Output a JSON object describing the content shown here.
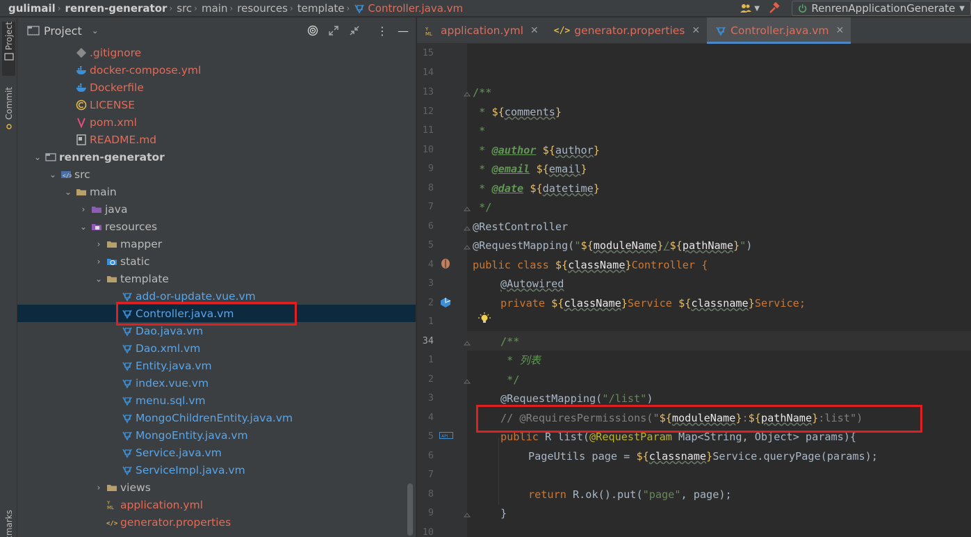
{
  "navbar": {
    "crumbs": [
      "gulimail",
      "renren-generator",
      "src",
      "main",
      "resources",
      "template",
      "Controller.java.vm"
    ],
    "run_config": "RenrenApplicationGenerate"
  },
  "left_strip": {
    "project_tab": "Project",
    "commit_tab": "Commit",
    "bookmarks_tab": "Bookmarks"
  },
  "project_panel": {
    "title": "Project",
    "tree": [
      {
        "label": ".gitignore",
        "depth": 3,
        "color": "red",
        "icon": "gitignore-icon"
      },
      {
        "label": "docker-compose.yml",
        "depth": 3,
        "color": "red",
        "icon": "docker-icon"
      },
      {
        "label": "Dockerfile",
        "depth": 3,
        "color": "red",
        "icon": "docker-icon"
      },
      {
        "label": "LICENSE",
        "depth": 3,
        "color": "red",
        "icon": "license-icon"
      },
      {
        "label": "pom.xml",
        "depth": 3,
        "color": "red",
        "icon": "maven-icon"
      },
      {
        "label": "README.md",
        "depth": 3,
        "color": "red",
        "icon": "markdown-icon"
      },
      {
        "label": "renren-generator",
        "depth": 1,
        "color": "bold",
        "icon": "module-folder-icon",
        "arrow": "down"
      },
      {
        "label": "src",
        "depth": 2,
        "color": "norm",
        "icon": "source-folder-icon",
        "arrow": "down"
      },
      {
        "label": "main",
        "depth": 3,
        "color": "norm",
        "icon": "folder-icon",
        "arrow": "down"
      },
      {
        "label": "java",
        "depth": 4,
        "color": "norm",
        "icon": "java-folder-icon",
        "arrow": "right"
      },
      {
        "label": "resources",
        "depth": 4,
        "color": "norm",
        "icon": "resources-folder-icon",
        "arrow": "down"
      },
      {
        "label": "mapper",
        "depth": 5,
        "color": "norm",
        "icon": "folder-icon",
        "arrow": "right"
      },
      {
        "label": "static",
        "depth": 5,
        "color": "norm",
        "icon": "web-folder-icon",
        "arrow": "right"
      },
      {
        "label": "template",
        "depth": 5,
        "color": "norm",
        "icon": "folder-icon",
        "arrow": "down"
      },
      {
        "label": "add-or-update.vue.vm",
        "depth": 6,
        "color": "blue",
        "icon": "velocity-icon"
      },
      {
        "label": "Controller.java.vm",
        "depth": 6,
        "color": "blue",
        "icon": "velocity-icon",
        "selected": true
      },
      {
        "label": "Dao.java.vm",
        "depth": 6,
        "color": "blue",
        "icon": "velocity-icon"
      },
      {
        "label": "Dao.xml.vm",
        "depth": 6,
        "color": "blue",
        "icon": "velocity-icon"
      },
      {
        "label": "Entity.java.vm",
        "depth": 6,
        "color": "blue",
        "icon": "velocity-icon"
      },
      {
        "label": "index.vue.vm",
        "depth": 6,
        "color": "blue",
        "icon": "velocity-icon"
      },
      {
        "label": "menu.sql.vm",
        "depth": 6,
        "color": "blue",
        "icon": "velocity-icon"
      },
      {
        "label": "MongoChildrenEntity.java.vm",
        "depth": 6,
        "color": "blue",
        "icon": "velocity-icon"
      },
      {
        "label": "MongoEntity.java.vm",
        "depth": 6,
        "color": "blue",
        "icon": "velocity-icon"
      },
      {
        "label": "Service.java.vm",
        "depth": 6,
        "color": "blue",
        "icon": "velocity-icon"
      },
      {
        "label": "ServiceImpl.java.vm",
        "depth": 6,
        "color": "blue",
        "icon": "velocity-icon"
      },
      {
        "label": "views",
        "depth": 5,
        "color": "norm",
        "icon": "folder-icon",
        "arrow": "right"
      },
      {
        "label": "application.yml",
        "depth": 5,
        "color": "red",
        "icon": "yaml-icon"
      },
      {
        "label": "generator.properties",
        "depth": 5,
        "color": "red",
        "icon": "properties-icon"
      }
    ]
  },
  "tabs": [
    {
      "label": "application.yml",
      "icon": "yaml-icon"
    },
    {
      "label": "generator.properties",
      "icon": "properties-icon"
    },
    {
      "label": "Controller.java.vm",
      "icon": "velocity-icon",
      "active": true
    }
  ],
  "editor": {
    "line_numbers": [
      "15",
      "14",
      "13",
      "12",
      "11",
      "10",
      "9",
      "8",
      "7",
      "6",
      "5",
      "4",
      "3",
      "2",
      "1",
      "34",
      "1",
      "2",
      "3",
      "4",
      "5",
      "6",
      "7",
      "8",
      "9",
      "10"
    ],
    "current_line_index": 15,
    "code": {
      "l13": "/**",
      "l12_a": " * ",
      "l12_b": "${",
      "l12_c": "comments",
      "l12_d": "}",
      "l11": " *",
      "l10_a": " * ",
      "l10_tag": "@author",
      "l10_sp": " ",
      "l10_b": "${",
      "l10_c": "author",
      "l10_d": "}",
      "l9_a": " * ",
      "l9_tag": "@email",
      "l9_sp": " ",
      "l9_b": "${",
      "l9_c": "email",
      "l9_d": "}",
      "l8_a": " * ",
      "l8_tag": "@date",
      "l8_sp": " ",
      "l8_b": "${",
      "l8_c": "datetime",
      "l8_d": "}",
      "l7": " */",
      "l6": "@RestController",
      "l5_a": "@RequestMapping(",
      "l5_b": "\"",
      "l5_c": "${",
      "l5_d": "moduleName",
      "l5_e": "}",
      "l5_f": "/",
      "l5_g": "${",
      "l5_h": "pathName",
      "l5_i": "}",
      "l5_j": "\"",
      "l5_k": ")",
      "l4_a": "public class ",
      "l4_b": "${",
      "l4_c": "className",
      "l4_d": "}",
      "l4_e": "Controller {",
      "l3": "@Autowired",
      "l2_a": "private ",
      "l2_b": "${",
      "l2_c": "className",
      "l2_d": "}",
      "l2_e": "Service ",
      "l2_f": "${",
      "l2_g": "classname",
      "l2_h": "}",
      "l2_i": "Service;",
      "c34": "/**",
      "c1_a": " * ",
      "c1_b": "列表",
      "c2": " */",
      "c3_a": "@RequestMapping(",
      "c3_b": "\"/list\"",
      "c3_c": ")",
      "c4_a": "// @RequiresPermissions(\"",
      "c4_b": "${",
      "c4_c": "moduleName",
      "c4_d": "}",
      "c4_e": ":",
      "c4_f": "${",
      "c4_g": "pathName",
      "c4_h": "}",
      "c4_i": ":list\")",
      "c5_a": "public ",
      "c5_b": "R list(",
      "c5_c": "@RequestParam",
      "c5_d": " Map<String, Object> params){",
      "c6_a": "PageUtils page = ",
      "c6_b": "${",
      "c6_c": "classname",
      "c6_d": "}",
      "c6_e": "Service.queryPage(params);",
      "c8_a": "return ",
      "c8_b": "R.ok().put(",
      "c8_c": "\"page\"",
      "c8_d": ", page);",
      "c9": "}"
    }
  }
}
